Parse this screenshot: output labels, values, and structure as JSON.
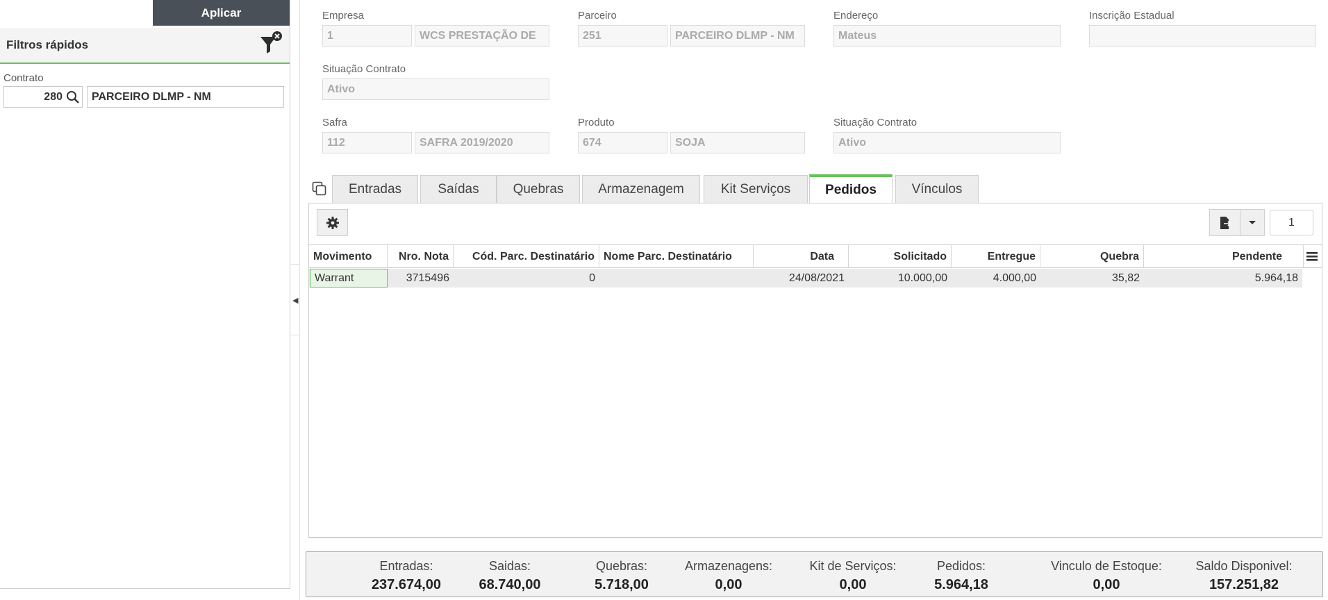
{
  "left_panel": {
    "apply_label": "Aplicar",
    "filters_title": "Filtros rápidos",
    "contract_label": "Contrato",
    "contract_code": "280",
    "contract_name": "PARCEIRO DLMP - NM"
  },
  "form": {
    "empresa": {
      "label": "Empresa",
      "code": "1",
      "name": "WCS PRESTAÇÃO DE"
    },
    "parceiro": {
      "label": "Parceiro",
      "code": "251",
      "name": "PARCEIRO DLMP - NM"
    },
    "endereco": {
      "label": "Endereço",
      "value": "Mateus"
    },
    "inscricao": {
      "label": "Inscrição Estadual",
      "value": ""
    },
    "situacao1": {
      "label": "Situação Contrato",
      "value": "Ativo"
    },
    "safra": {
      "label": "Safra",
      "code": "112",
      "name": "SAFRA 2019/2020"
    },
    "produto": {
      "label": "Produto",
      "code": "674",
      "name": "SOJA"
    },
    "situacao2": {
      "label": "Situação Contrato",
      "value": "Ativo"
    }
  },
  "tabs": [
    {
      "label": "Entradas"
    },
    {
      "label": "Saídas"
    },
    {
      "label": "Quebras"
    },
    {
      "label": "Armazenagem"
    },
    {
      "label": "Kit Serviços"
    },
    {
      "label": "Pedidos",
      "active": true
    },
    {
      "label": "Vínculos"
    }
  ],
  "grid": {
    "page": "1",
    "columns": [
      "Movimento",
      "Nro. Nota",
      "Cód. Parc. Destinatário",
      "Nome Parc. Destinatário",
      "Data",
      "Solicitado",
      "Entregue",
      "Quebra",
      "Pendente"
    ],
    "rows": [
      [
        "Warrant",
        "3715496",
        "0",
        "",
        "24/08/2021",
        "10.000,00",
        "4.000,00",
        "35,82",
        "5.964,18"
      ]
    ]
  },
  "totals": [
    {
      "label": "Entradas:",
      "value": "237.674,00"
    },
    {
      "label": "Saidas:",
      "value": "68.740,00"
    },
    {
      "label": "Quebras:",
      "value": "5.718,00"
    },
    {
      "label": "Armazenagens:",
      "value": "0,00"
    },
    {
      "label": "Kit de Serviços:",
      "value": "0,00"
    },
    {
      "label": "Pedidos:",
      "value": "5.964,18"
    },
    {
      "label": "Vinculo de Estoque:",
      "value": "0,00"
    },
    {
      "label": "Saldo Disponivel:",
      "value": "157.251,82"
    }
  ],
  "colors": {
    "accent_green": "#66c25c",
    "apply_button": "#4a5057"
  }
}
